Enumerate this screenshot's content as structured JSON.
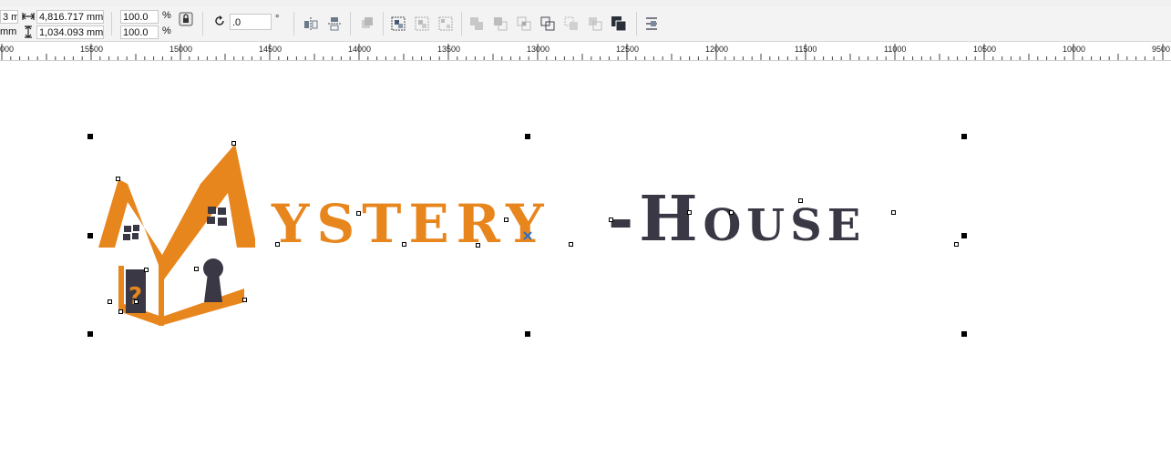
{
  "toolbar": {
    "x_value_partial": "3 m",
    "y_unit_partial": "mm",
    "width_value": "4,816.717 mm",
    "height_value": "1,034.093 mm",
    "scale_x": "100.0",
    "scale_y": "100.0",
    "percent_symbol": "%",
    "rotation_value": ".0",
    "degree_symbol": "°"
  },
  "ruler": {
    "labels": [
      "000",
      "15500",
      "15000",
      "14500",
      "14000",
      "13500",
      "13000",
      "12500",
      "12000",
      "11500",
      "11000",
      "10500",
      "10000",
      "9500"
    ]
  },
  "artwork": {
    "text_orange": "YSTERY",
    "text_dark": "-House",
    "colors": {
      "orange": "#e8861e",
      "dark": "#393844"
    },
    "door_mark": "?"
  }
}
